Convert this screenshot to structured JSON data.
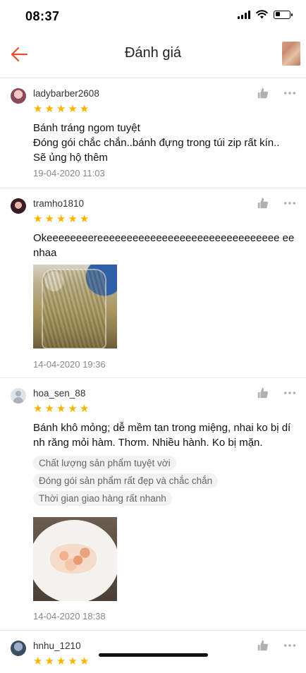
{
  "status_bar": {
    "time": "08:37",
    "battery_level": 0.35
  },
  "header": {
    "title": "Đánh giá"
  },
  "icons": {
    "back": "arrow-left-icon",
    "like": "thumbs-up-icon",
    "more": "more-horizontal-icon",
    "star": "star-icon"
  },
  "colors": {
    "accent": "#ee4d2d",
    "star": "#f7b500",
    "tag_bg": "#f2f2f2"
  },
  "reviews": [
    {
      "username": "ladybarber2608",
      "rating": 5,
      "text": "Bánh tráng ngom tuyệt\nĐóng gói chắc chắn..bánh đựng trong túi zip rất kín..\nSẽ ủng hộ thêm",
      "date": "19-04-2020 11:03"
    },
    {
      "username": "tramho1810",
      "rating": 5,
      "text": "Okeeeeeeeereeeeeeeeeeeeeeeeeeeeeeeeeeeeeee ee nhaa",
      "date": "14-04-2020 19:36"
    },
    {
      "username": "hoa_sen_88",
      "rating": 5,
      "text": "Bánh khô mỏng; dễ mềm tan trong miệng, nhai ko bị dính răng mỏi hàm. Thơm. Nhiều hành. Ko bị mặn.",
      "tags": [
        "Chất lượng sản phẩm tuyệt vời",
        "Đóng gói sản phẩm rất đẹp và chắc chắn",
        "Thời gian giao hàng rất nhanh"
      ],
      "date": "14-04-2020 18:38"
    },
    {
      "username": "hnhu_1210",
      "rating": 5
    }
  ]
}
